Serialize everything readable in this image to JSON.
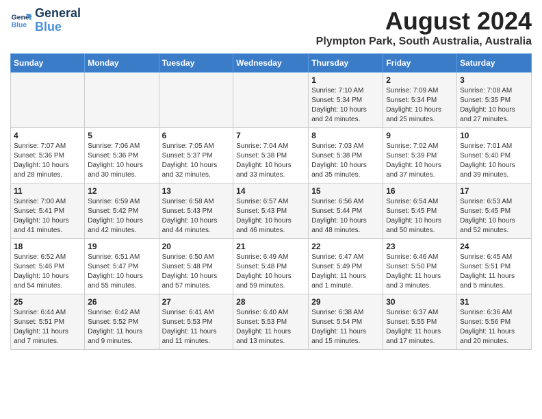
{
  "header": {
    "logo_line1": "General",
    "logo_line2": "Blue",
    "main_title": "August 2024",
    "subtitle": "Plympton Park, South Australia, Australia"
  },
  "weekdays": [
    "Sunday",
    "Monday",
    "Tuesday",
    "Wednesday",
    "Thursday",
    "Friday",
    "Saturday"
  ],
  "weeks": [
    [
      {
        "day": "",
        "detail": ""
      },
      {
        "day": "",
        "detail": ""
      },
      {
        "day": "",
        "detail": ""
      },
      {
        "day": "",
        "detail": ""
      },
      {
        "day": "1",
        "detail": "Sunrise: 7:10 AM\nSunset: 5:34 PM\nDaylight: 10 hours\nand 24 minutes."
      },
      {
        "day": "2",
        "detail": "Sunrise: 7:09 AM\nSunset: 5:34 PM\nDaylight: 10 hours\nand 25 minutes."
      },
      {
        "day": "3",
        "detail": "Sunrise: 7:08 AM\nSunset: 5:35 PM\nDaylight: 10 hours\nand 27 minutes."
      }
    ],
    [
      {
        "day": "4",
        "detail": "Sunrise: 7:07 AM\nSunset: 5:36 PM\nDaylight: 10 hours\nand 28 minutes."
      },
      {
        "day": "5",
        "detail": "Sunrise: 7:06 AM\nSunset: 5:36 PM\nDaylight: 10 hours\nand 30 minutes."
      },
      {
        "day": "6",
        "detail": "Sunrise: 7:05 AM\nSunset: 5:37 PM\nDaylight: 10 hours\nand 32 minutes."
      },
      {
        "day": "7",
        "detail": "Sunrise: 7:04 AM\nSunset: 5:38 PM\nDaylight: 10 hours\nand 33 minutes."
      },
      {
        "day": "8",
        "detail": "Sunrise: 7:03 AM\nSunset: 5:38 PM\nDaylight: 10 hours\nand 35 minutes."
      },
      {
        "day": "9",
        "detail": "Sunrise: 7:02 AM\nSunset: 5:39 PM\nDaylight: 10 hours\nand 37 minutes."
      },
      {
        "day": "10",
        "detail": "Sunrise: 7:01 AM\nSunset: 5:40 PM\nDaylight: 10 hours\nand 39 minutes."
      }
    ],
    [
      {
        "day": "11",
        "detail": "Sunrise: 7:00 AM\nSunset: 5:41 PM\nDaylight: 10 hours\nand 41 minutes."
      },
      {
        "day": "12",
        "detail": "Sunrise: 6:59 AM\nSunset: 5:42 PM\nDaylight: 10 hours\nand 42 minutes."
      },
      {
        "day": "13",
        "detail": "Sunrise: 6:58 AM\nSunset: 5:43 PM\nDaylight: 10 hours\nand 44 minutes."
      },
      {
        "day": "14",
        "detail": "Sunrise: 6:57 AM\nSunset: 5:43 PM\nDaylight: 10 hours\nand 46 minutes."
      },
      {
        "day": "15",
        "detail": "Sunrise: 6:56 AM\nSunset: 5:44 PM\nDaylight: 10 hours\nand 48 minutes."
      },
      {
        "day": "16",
        "detail": "Sunrise: 6:54 AM\nSunset: 5:45 PM\nDaylight: 10 hours\nand 50 minutes."
      },
      {
        "day": "17",
        "detail": "Sunrise: 6:53 AM\nSunset: 5:45 PM\nDaylight: 10 hours\nand 52 minutes."
      }
    ],
    [
      {
        "day": "18",
        "detail": "Sunrise: 6:52 AM\nSunset: 5:46 PM\nDaylight: 10 hours\nand 54 minutes."
      },
      {
        "day": "19",
        "detail": "Sunrise: 6:51 AM\nSunset: 5:47 PM\nDaylight: 10 hours\nand 55 minutes."
      },
      {
        "day": "20",
        "detail": "Sunrise: 6:50 AM\nSunset: 5:48 PM\nDaylight: 10 hours\nand 57 minutes."
      },
      {
        "day": "21",
        "detail": "Sunrise: 6:49 AM\nSunset: 5:48 PM\nDaylight: 10 hours\nand 59 minutes."
      },
      {
        "day": "22",
        "detail": "Sunrise: 6:47 AM\nSunset: 5:49 PM\nDaylight: 11 hours\nand 1 minute."
      },
      {
        "day": "23",
        "detail": "Sunrise: 6:46 AM\nSunset: 5:50 PM\nDaylight: 11 hours\nand 3 minutes."
      },
      {
        "day": "24",
        "detail": "Sunrise: 6:45 AM\nSunset: 5:51 PM\nDaylight: 11 hours\nand 5 minutes."
      }
    ],
    [
      {
        "day": "25",
        "detail": "Sunrise: 6:44 AM\nSunset: 5:51 PM\nDaylight: 11 hours\nand 7 minutes."
      },
      {
        "day": "26",
        "detail": "Sunrise: 6:42 AM\nSunset: 5:52 PM\nDaylight: 11 hours\nand 9 minutes."
      },
      {
        "day": "27",
        "detail": "Sunrise: 6:41 AM\nSunset: 5:53 PM\nDaylight: 11 hours\nand 11 minutes."
      },
      {
        "day": "28",
        "detail": "Sunrise: 6:40 AM\nSunset: 5:53 PM\nDaylight: 11 hours\nand 13 minutes."
      },
      {
        "day": "29",
        "detail": "Sunrise: 6:38 AM\nSunset: 5:54 PM\nDaylight: 11 hours\nand 15 minutes."
      },
      {
        "day": "30",
        "detail": "Sunrise: 6:37 AM\nSunset: 5:55 PM\nDaylight: 11 hours\nand 17 minutes."
      },
      {
        "day": "31",
        "detail": "Sunrise: 6:36 AM\nSunset: 5:56 PM\nDaylight: 11 hours\nand 20 minutes."
      }
    ]
  ]
}
